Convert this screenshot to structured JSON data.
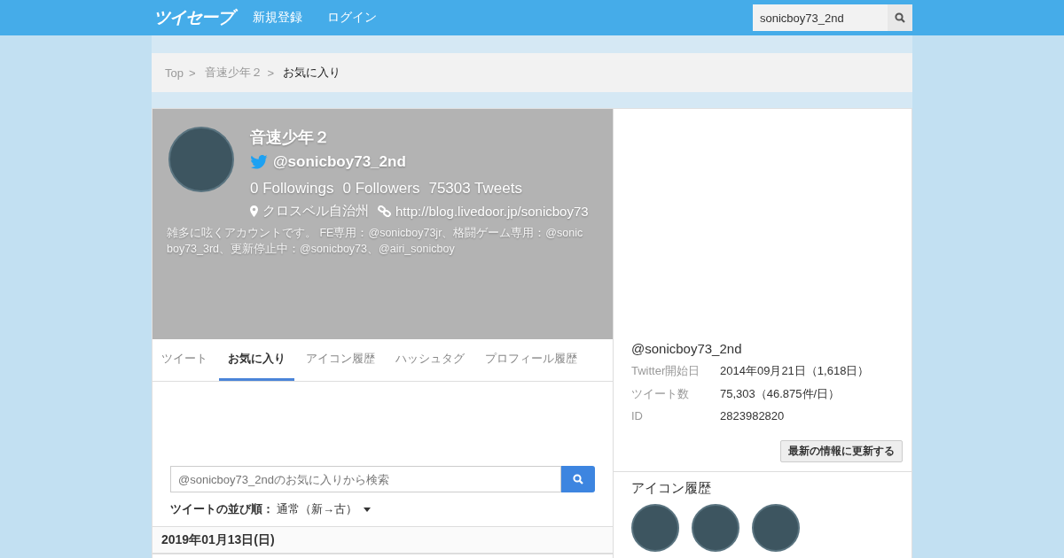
{
  "header": {
    "logo": "ツイセーブ",
    "nav": [
      "新規登録",
      "ログイン"
    ],
    "search": {
      "value": "sonicboy73_2nd"
    }
  },
  "breadcrumb": [
    {
      "label": "Top",
      "current": false
    },
    {
      "label": "音速少年２",
      "current": false
    },
    {
      "label": "お気に入り",
      "current": true
    }
  ],
  "breadcrumb_separator": ">",
  "profile": {
    "name": "音速少年２",
    "handle": "@sonicboy73_2nd",
    "stats": [
      "0 Followings",
      "0 Followers",
      "75303 Tweets"
    ],
    "location": "クロスベル自治州",
    "url": "http://blog.livedoor.jp/sonicboy73",
    "bio": "雑多に呟くアカウントです。 FE専用：@sonicboy73jr、格闘ゲーム専用：@sonicboy73_3rd、更新停止中：@sonicboy73、@airi_sonicboy"
  },
  "tabs": [
    {
      "label": "ツイート",
      "selected": false
    },
    {
      "label": "お気に入り",
      "selected": true
    },
    {
      "label": "アイコン履歴",
      "selected": false
    },
    {
      "label": "ハッシュタグ",
      "selected": false
    },
    {
      "label": "プロフィール履歴",
      "selected": false
    }
  ],
  "favorites_search": {
    "placeholder": "@sonicboy73_2ndのお気に入りから検索"
  },
  "sort": {
    "label": "ツイートの並び順：",
    "value": "通常（新→古）"
  },
  "date_header": "2019年01月13日(日)",
  "info": {
    "handle": "@sonicboy73_2nd",
    "rows": [
      {
        "label": "Twitter開始日",
        "value": "2014年09月21日（1,618日）"
      },
      {
        "label": "ツイート数",
        "value": "75,303（46.875件/日）"
      },
      {
        "label": "ID",
        "value": "2823982820"
      }
    ],
    "refresh_button": "最新の情報に更新する"
  },
  "icon_history": {
    "title": "アイコン履歴",
    "icons": [
      {
        "kind": "avatar"
      },
      {
        "kind": "avatar"
      },
      {
        "kind": "avatar"
      }
    ]
  }
}
